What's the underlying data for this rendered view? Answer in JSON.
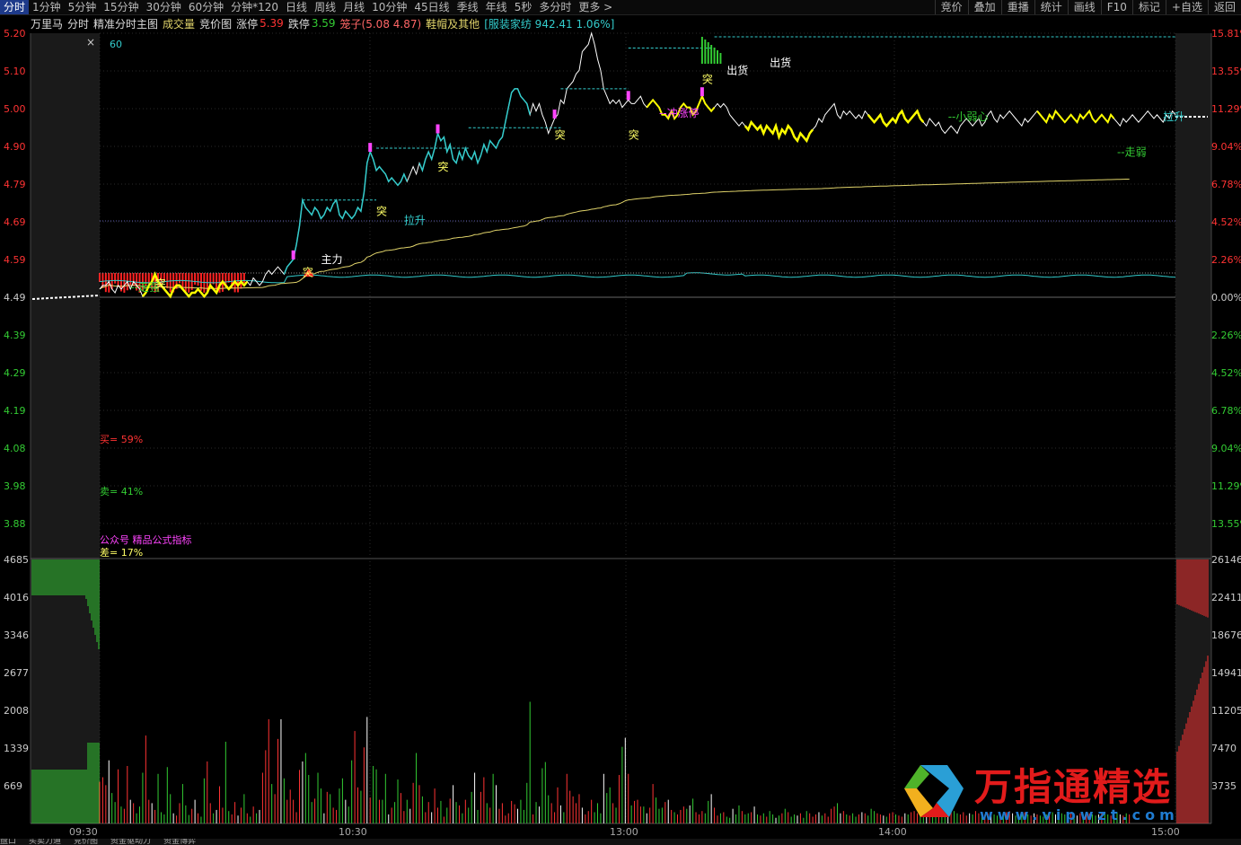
{
  "periods": [
    "分时",
    "1分钟",
    "5分钟",
    "15分钟",
    "30分钟",
    "60分钟",
    "分钟*120",
    "日线",
    "周线",
    "月线",
    "10分钟",
    "45日线",
    "季线",
    "年线",
    "5秒",
    "多分时",
    "更多 >"
  ],
  "active_period": "分时",
  "tools": [
    "竞价",
    "叠加",
    "重播",
    "统计",
    "画线",
    "F10",
    "标记",
    "+自选",
    "返回"
  ],
  "info": {
    "stock_name": "万里马",
    "view": "分时",
    "indicator": "精准分时主图",
    "volume_label": "成交量",
    "auction_label": "竞价图",
    "limit_up_label": "涨停",
    "limit_up_value": "5.39",
    "limit_down_label": "跌停",
    "limit_down_value": "3.59",
    "cage_label": "笼子(5.08 4.87)",
    "sector": "鞋帽及其他",
    "industry": "[服装家纺 942.41 1.06%]"
  },
  "colors": {
    "up": "#ff3333",
    "down": "#33cc33",
    "price_line": "#ffffff",
    "avg_line": "#e0d36a",
    "highlight": "#ffff00",
    "cyan": "#33cccc",
    "magenta": "#ff44ff"
  },
  "price_axis": [
    "5.20",
    "5.10",
    "5.00",
    "4.90",
    "4.79",
    "4.69",
    "4.59",
    "4.49",
    "4.39",
    "4.29",
    "4.19",
    "4.08",
    "3.98",
    "3.88"
  ],
  "pct_axis": [
    "15.81%",
    "13.55%",
    "11.29%",
    "9.04%",
    "6.78%",
    "4.52%",
    "2.26%",
    "0.00%",
    "2.26%",
    "4.52%",
    "6.78%",
    "9.04%",
    "11.29%",
    "13.55%"
  ],
  "vol_axis_left": [
    "4685",
    "4016",
    "3346",
    "2677",
    "2008",
    "1339",
    "669"
  ],
  "vol_axis_right": [
    "26146",
    "22411",
    "18676",
    "14941",
    "11205",
    "7470",
    "3735"
  ],
  "time_labels": [
    "09:30",
    "10:30",
    "13:00",
    "14:00",
    "15:00"
  ],
  "close_icon": "close-icon",
  "period_label": "60",
  "buy_text": "买= 59%",
  "sell_text": "卖= 41%",
  "promo_text": "公众号 精品公式指标",
  "diff_text": "差= 17%",
  "annotations": [
    {
      "text": "--走强",
      "color": "#33cc33",
      "time": 10,
      "price": 4.505
    },
    {
      "text": "突",
      "color": "#ffff66",
      "time": 18,
      "price": 4.515
    },
    {
      "text": "主力",
      "color": "#ffffff",
      "time": 72,
      "price": 4.58
    },
    {
      "text": "突",
      "color": "#ffff66",
      "time": 66,
      "price": 4.545
    },
    {
      "text": "突",
      "color": "#ffff66",
      "time": 90,
      "price": 4.71
    },
    {
      "text": "拉升",
      "color": "#33cccc",
      "time": 99,
      "price": 4.685
    },
    {
      "text": "突",
      "color": "#ffff66",
      "time": 110,
      "price": 4.83
    },
    {
      "text": "突",
      "color": "#ffff66",
      "time": 148,
      "price": 4.915
    },
    {
      "text": "突",
      "color": "#ffff66",
      "time": 172,
      "price": 4.915
    },
    {
      "text": "--冲涨停",
      "color": "#ff44ff",
      "time": 182,
      "price": 4.975
    },
    {
      "text": "突",
      "color": "#ffff66",
      "time": 196,
      "price": 5.065
    },
    {
      "text": "出货",
      "color": "#ffffff",
      "time": 218,
      "price": 5.11
    },
    {
      "text": "出货",
      "color": "#ffffff",
      "time": 204,
      "price": 5.09
    },
    {
      "text": "--小弱心",
      "color": "#33cc33",
      "time": 276,
      "price": 4.965
    },
    {
      "text": "--走弱",
      "color": "#33cc33",
      "time": 331,
      "price": 4.87
    },
    {
      "text": "拉升",
      "color": "#33cccc",
      "time": 346,
      "price": 4.965
    }
  ],
  "watermark": {
    "title": "万指通精选",
    "url": "www.vipwzt.com"
  },
  "bottom_tabs": [
    "盘口",
    "买卖力道",
    "竞价图",
    "资金驱动力",
    "资金博弈"
  ],
  "chart_data": {
    "type": "line",
    "x_label_ticks": [
      "09:30",
      "10:30",
      "13:00",
      "14:00",
      "15:00"
    ],
    "prev_close": 4.49,
    "price_range": [
      3.88,
      5.2
    ],
    "vol_range": [
      0,
      4685
    ],
    "price": [
      4.51,
      4.52,
      4.52,
      4.53,
      4.51,
      4.5,
      4.52,
      4.51,
      4.52,
      4.53,
      4.51,
      4.53,
      4.52,
      4.51,
      4.49,
      4.5,
      4.52,
      4.53,
      4.55,
      4.53,
      4.52,
      4.51,
      4.5,
      4.49,
      4.51,
      4.52,
      4.52,
      4.51,
      4.5,
      4.49,
      4.5,
      4.5,
      4.51,
      4.5,
      4.49,
      4.5,
      4.52,
      4.51,
      4.5,
      4.52,
      4.53,
      4.52,
      4.51,
      4.52,
      4.53,
      4.52,
      4.53,
      4.52,
      4.53,
      4.52,
      4.54,
      4.53,
      4.52,
      4.53,
      4.55,
      4.56,
      4.55,
      4.56,
      4.57,
      4.56,
      4.55,
      4.57,
      4.58,
      4.59,
      4.63,
      4.68,
      4.75,
      4.73,
      4.72,
      4.71,
      4.73,
      4.72,
      4.7,
      4.71,
      4.73,
      4.72,
      4.74,
      4.75,
      4.71,
      4.7,
      4.72,
      4.71,
      4.7,
      4.71,
      4.73,
      4.72,
      4.77,
      4.85,
      4.88,
      4.86,
      4.83,
      4.84,
      4.83,
      4.82,
      4.8,
      4.81,
      4.8,
      4.79,
      4.8,
      4.82,
      4.8,
      4.82,
      4.84,
      4.82,
      4.85,
      4.83,
      4.86,
      4.88,
      4.86,
      4.89,
      4.93,
      4.91,
      4.92,
      4.88,
      4.9,
      4.86,
      4.85,
      4.88,
      4.86,
      4.89,
      4.87,
      4.86,
      4.88,
      4.85,
      4.87,
      4.9,
      4.88,
      4.91,
      4.9,
      4.89,
      4.91,
      4.92,
      4.96,
      5.0,
      5.04,
      5.05,
      5.05,
      5.03,
      5.02,
      5.01,
      4.98,
      5.01,
      4.99,
      5.01,
      4.98,
      4.96,
      4.93,
      4.95,
      4.97,
      4.98,
      5.02,
      5.01,
      5.05,
      5.06,
      5.07,
      5.09,
      5.1,
      5.15,
      5.16,
      5.17,
      5.2,
      5.17,
      5.13,
      5.1,
      5.05,
      5.03,
      5.01,
      5.02,
      5.01,
      5.02,
      5.0,
      5.01,
      5.02,
      5.01,
      5.01,
      5.02,
      5.03,
      5.01,
      5.0,
      5.01,
      5.02,
      5.01,
      5.0,
      4.98,
      4.98,
      4.97,
      4.99,
      4.97,
      4.98,
      5.0,
      5.01,
      5.0,
      5.0,
      4.98,
      4.99,
      5.01,
      5.03,
      5.01,
      5.0,
      4.99,
      5.0,
      5.01,
      5.0,
      5.01,
      5.0,
      4.98,
      4.97,
      4.96,
      4.95,
      4.96,
      4.95,
      4.94,
      4.96,
      4.95,
      4.94,
      4.95,
      4.93,
      4.95,
      4.94,
      4.93,
      4.95,
      4.92,
      4.94,
      4.93,
      4.95,
      4.94,
      4.92,
      4.91,
      4.93,
      4.92,
      4.91,
      4.93,
      4.94,
      4.95,
      4.97,
      4.96,
      4.98,
      4.99,
      5.0,
      5.01,
      4.98,
      4.97,
      4.99,
      4.98,
      4.99,
      4.98,
      4.97,
      4.98,
      4.97,
      4.99,
      4.98,
      4.97,
      4.96,
      4.97,
      4.98,
      4.96,
      4.95,
      4.96,
      4.97,
      4.96,
      4.98,
      4.99,
      4.97,
      4.96,
      4.97,
      4.98,
      4.99,
      4.97,
      4.96,
      4.95,
      4.97,
      4.96,
      4.95,
      4.96,
      4.94,
      4.93,
      4.94,
      4.95,
      4.94,
      4.93,
      4.95,
      4.96,
      4.97,
      4.96,
      4.95,
      4.96,
      4.97,
      4.95,
      4.96,
      4.98,
      4.99,
      4.97,
      4.96,
      4.98,
      4.97,
      4.98,
      4.99,
      4.98,
      4.97,
      4.96,
      4.95,
      4.97,
      4.96,
      4.97,
      4.98,
      4.99,
      4.98,
      4.97,
      4.96,
      4.98,
      4.97,
      4.99,
      4.98,
      4.97,
      4.96,
      4.97,
      4.98,
      4.97,
      4.96,
      4.98,
      4.97,
      4.98,
      4.99,
      4.97,
      4.96,
      4.97,
      4.98,
      4.97,
      4.96,
      4.98,
      4.97,
      4.96,
      4.95,
      4.97,
      4.96,
      4.97,
      4.98,
      4.97,
      4.96,
      4.97,
      4.98,
      4.99,
      4.98,
      4.97,
      4.98,
      4.97,
      4.96,
      4.98,
      4.97,
      4.99,
      4.98
    ],
    "volume": [
      740,
      820,
      680,
      1120,
      540,
      380,
      960,
      300,
      260,
      1020,
      420,
      360,
      180,
      300,
      900,
      1560,
      420,
      360,
      240,
      880,
      200,
      160,
      1000,
      520,
      180,
      140,
      360,
      700,
      320,
      150,
      260,
      420,
      180,
      120,
      800,
      1100,
      360,
      180,
      240,
      660,
      280,
      1450,
      220,
      160,
      380,
      140,
      280,
      520,
      180,
      120,
      300,
      180,
      240,
      900,
      1300,
      1850,
      700,
      520,
      1500,
      1850,
      800,
      420,
      600,
      420,
      200,
      950,
      1100,
      1250,
      860,
      380,
      440,
      900,
      620,
      180,
      560,
      520,
      280,
      240,
      620,
      800,
      420,
      300,
      1120,
      1640,
      640,
      580,
      1350,
      1890,
      460,
      1020,
      960,
      420,
      420,
      880,
      160,
      280,
      380,
      780,
      540,
      220,
      420,
      260,
      720,
      1250,
      680,
      480,
      200,
      380,
      200,
      620,
      280,
      400,
      120,
      280,
      440,
      680,
      380,
      320,
      180,
      420,
      280,
      560,
      900,
      240,
      560,
      820,
      360,
      280,
      880,
      680,
      260,
      360,
      140,
      180,
      400,
      340,
      260,
      420,
      240,
      720,
      2160,
      160,
      380,
      300,
      980,
      1090,
      500,
      360,
      200,
      640,
      320,
      200,
      880,
      580,
      480,
      360,
      520,
      280,
      160,
      220,
      420,
      200,
      360,
      180,
      880,
      540,
      640,
      360,
      280,
      860,
      1360,
      1520,
      880,
      320,
      400,
      420,
      300,
      300,
      180,
      280,
      700,
      460,
      260,
      280,
      380,
      420,
      240,
      200,
      160,
      240,
      300,
      260,
      320,
      440,
      200,
      160,
      220,
      180,
      400,
      520,
      280,
      140,
      180,
      200,
      120,
      100,
      260,
      160,
      320,
      220,
      160,
      180,
      200,
      300,
      160,
      140,
      180,
      120,
      220,
      160,
      100,
      140,
      180,
      260,
      200,
      120,
      160,
      140,
      180,
      100,
      220,
      180,
      120,
      160,
      200,
      140,
      180,
      120,
      260,
      300,
      360,
      180,
      220,
      160,
      140,
      180,
      120,
      160,
      200,
      180,
      140,
      260,
      220,
      180,
      160,
      140,
      120,
      180,
      200,
      160,
      140,
      120,
      180,
      160,
      200,
      220,
      180,
      160,
      140,
      120,
      180,
      160,
      140,
      200,
      180,
      160,
      140,
      260,
      220,
      180,
      160,
      200,
      140,
      180,
      160,
      220,
      180,
      140,
      160,
      180,
      200,
      160,
      140,
      180,
      160,
      200,
      220,
      180,
      140,
      160,
      180,
      200,
      160,
      140,
      180,
      160,
      140,
      120,
      160,
      180,
      200,
      160,
      140,
      180,
      160,
      200,
      180,
      160,
      140,
      180,
      160,
      200,
      180,
      160,
      140,
      160,
      180,
      200,
      160,
      140,
      180,
      200,
      160,
      140,
      180,
      160
    ],
    "annotations_note": "see page-data.annotations"
  }
}
